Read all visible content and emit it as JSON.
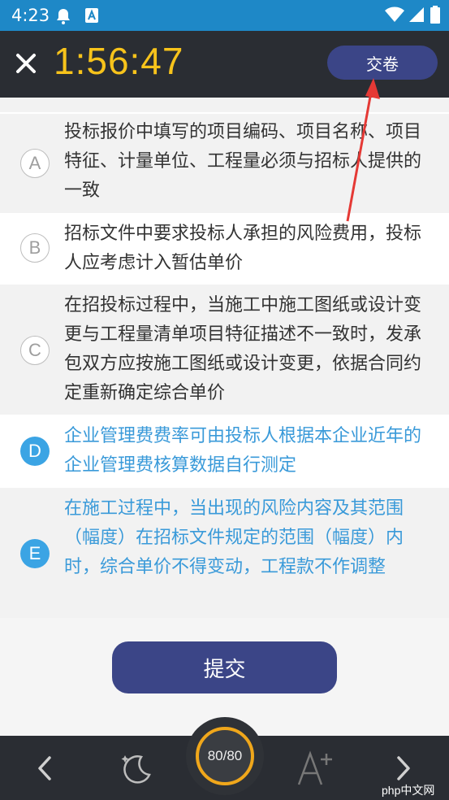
{
  "status_bar": {
    "time": "4:23"
  },
  "header": {
    "timer": "1:56:47",
    "submit_paper_label": "交卷"
  },
  "options": [
    {
      "letter": "A",
      "text": "投标报价中填写的项目编码、项目名称、项目特征、计量单位、工程量必须与招标人提供的一致",
      "selected": false
    },
    {
      "letter": "B",
      "text": "招标文件中要求投标人承担的风险费用，投标人应考虑计入暂估单价",
      "selected": false
    },
    {
      "letter": "C",
      "text": "在招投标过程中，当施工中施工图纸或设计变更与工程量清单项目特征描述不一致时，发承包双方应按施工图纸或设计变更，依据合同约定重新确定综合单价",
      "selected": false
    },
    {
      "letter": "D",
      "text": "企业管理费费率可由投标人根据本企业近年的企业管理费核算数据自行测定",
      "selected": true
    },
    {
      "letter": "E",
      "text": "在施工过程中，当出现的风险内容及其范围（幅度）在招标文件规定的范围（幅度）内时，综合单价不得变动，工程款不作调整",
      "selected": true
    }
  ],
  "submit_label": "提交",
  "bottom_bar": {
    "progress": "80/80",
    "font_size_icon": "A+"
  },
  "watermark": "php中文网",
  "colors": {
    "accent": "#3b4587",
    "timer": "#f7c31b",
    "selected": "#3ba4e4",
    "header_bg": "#2a2d33"
  },
  "icons": [
    "close-icon",
    "bell-icon",
    "notification-a-icon",
    "wifi-icon",
    "signal-icon",
    "battery-icon",
    "chevron-left-icon",
    "night-mode-icon",
    "font-size-icon",
    "chevron-right-icon"
  ]
}
